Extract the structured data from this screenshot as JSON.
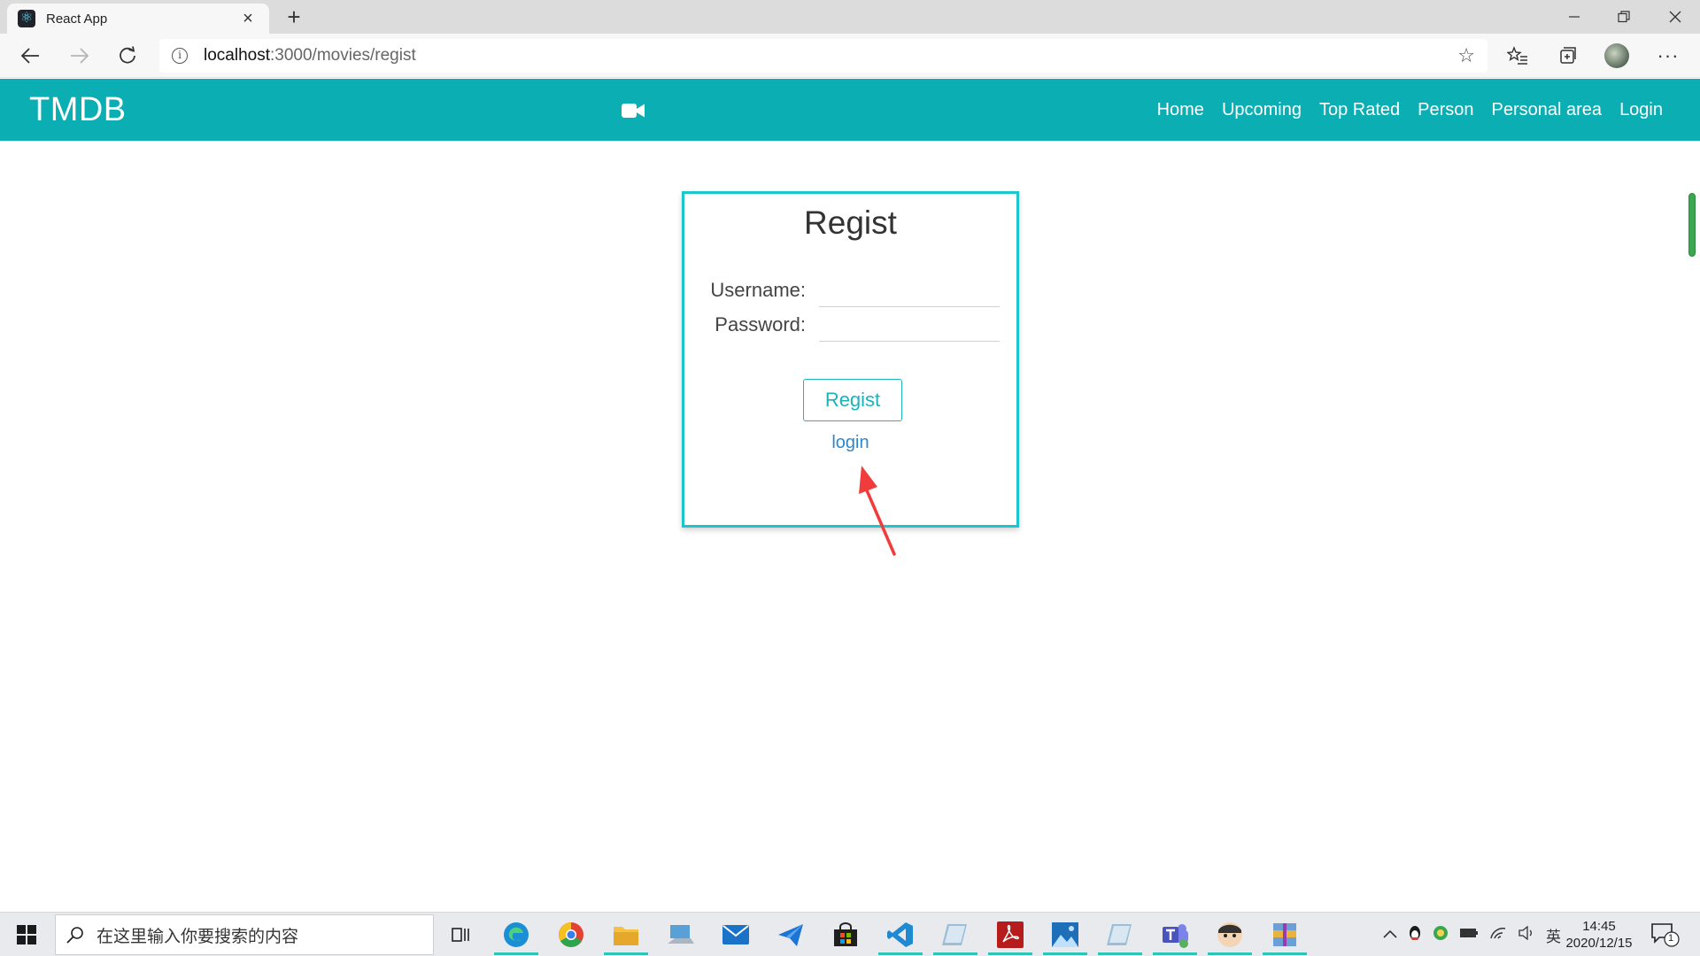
{
  "browser": {
    "tab_title": "React App",
    "new_tab": "+",
    "url_host": "localhost",
    "url_path": ":3000/movies/regist"
  },
  "navbar": {
    "brand": "TMDB",
    "links": [
      "Home",
      "Upcoming",
      "Top Rated",
      "Person",
      "Personal area",
      "Login"
    ]
  },
  "form": {
    "title": "Regist",
    "username_label": "Username:",
    "password_label": "Password:",
    "username_value": "",
    "password_value": "",
    "submit_label": "Regist",
    "login_link": "login"
  },
  "taskbar": {
    "search_placeholder": "在这里输入你要搜索的内容",
    "ime_indicator": "英",
    "time": "14:45",
    "date": "2020/12/15",
    "notification_count": "1"
  },
  "colors": {
    "navbar": "#0aaeb3",
    "card_border": "#1bc7cd",
    "link": "#2f86c9",
    "arrow": "#f03c3c"
  }
}
